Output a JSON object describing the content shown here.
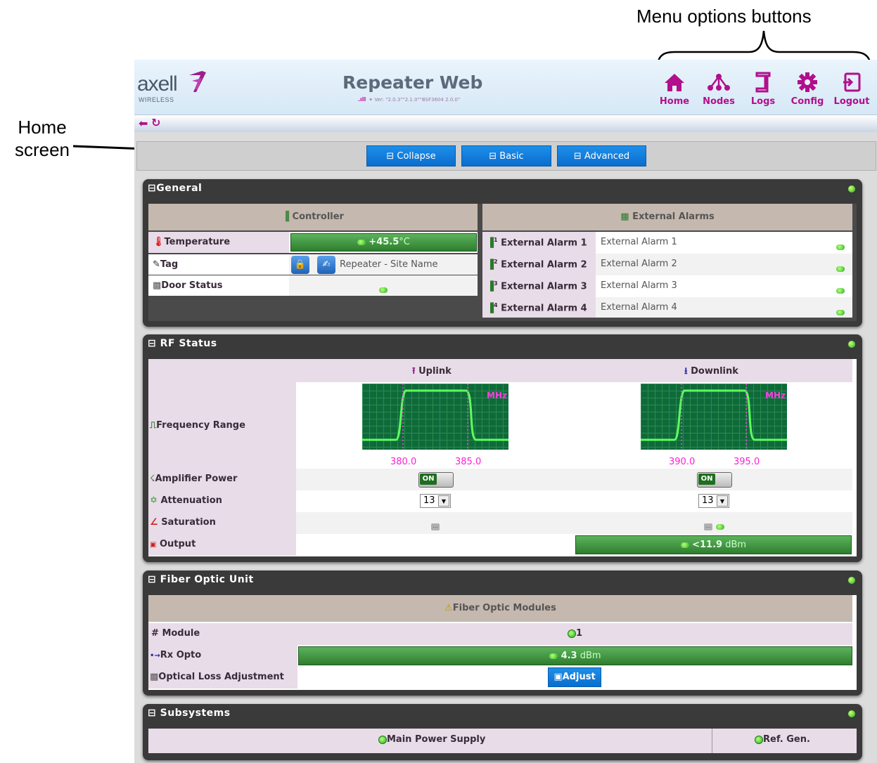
{
  "annotations": {
    "menu_options": "Menu options buttons",
    "home_screen": "Home screen"
  },
  "header": {
    "logo": "axell",
    "logo_sub": "WIRELESS",
    "title": "Repeater Web",
    "version": "✦ Ver: \"2.0.3\"\"2.1.0\"\"BSF3604 2.0.0\"",
    "menu": [
      {
        "label": "Home",
        "icon": "home-icon"
      },
      {
        "label": "Nodes",
        "icon": "nodes-icon"
      },
      {
        "label": "Logs",
        "icon": "logs-icon"
      },
      {
        "label": "Config",
        "icon": "gear-icon"
      },
      {
        "label": "Logout",
        "icon": "logout-icon"
      }
    ],
    "accent": "#b10f8c"
  },
  "viewbar": {
    "collapse": "⊟ Collapse",
    "basic": "⊟ Basic",
    "advanced": "⊟ Advanced"
  },
  "general": {
    "title": "⊟General",
    "controller": "Controller",
    "ext_alarms": "External Alarms",
    "temperature_label": "Temperature",
    "temperature_value": "+45.5",
    "temperature_unit": "°C",
    "tag_label": "Tag",
    "tag_value": "Repeater - Site Name",
    "door_label": "Door Status",
    "alarms": [
      {
        "label": "External Alarm 1",
        "value": "External Alarm 1",
        "num": "1"
      },
      {
        "label": "External Alarm 2",
        "value": "External Alarm 2",
        "num": "2"
      },
      {
        "label": "External Alarm 3",
        "value": "External Alarm 3",
        "num": "3"
      },
      {
        "label": "External Alarm 4",
        "value": "External Alarm 4",
        "num": "4"
      }
    ]
  },
  "rf": {
    "title": "⊟ RF Status",
    "uplink": "Uplink",
    "downlink": "Downlink",
    "freq_label": "Frequency Range",
    "mhz": "MHz",
    "up_low": "380.0",
    "up_high": "385.0",
    "down_low": "390.0",
    "down_high": "395.0",
    "amp_label": "Amplifier Power",
    "on": "ON",
    "att_label": "Attenuation",
    "att_up": "13",
    "att_down": "13",
    "sat_label": "Saturation",
    "out_label": "Output",
    "out_value": "<11.9",
    "out_unit": "dBm"
  },
  "fiber": {
    "title": "⊟ Fiber Optic Unit",
    "modules": "Fiber Optic Modules",
    "module_label": "Module",
    "module_value": "1",
    "rx_label": "Rx Opto",
    "rx_value": "4.3",
    "rx_unit": "dBm",
    "ola_label": "Optical Loss Adjustment",
    "adjust": "Adjust"
  },
  "subsystems": {
    "title": "⊟ Subsystems",
    "main_power": "Main Power Supply",
    "ref_gen": "Ref. Gen."
  }
}
